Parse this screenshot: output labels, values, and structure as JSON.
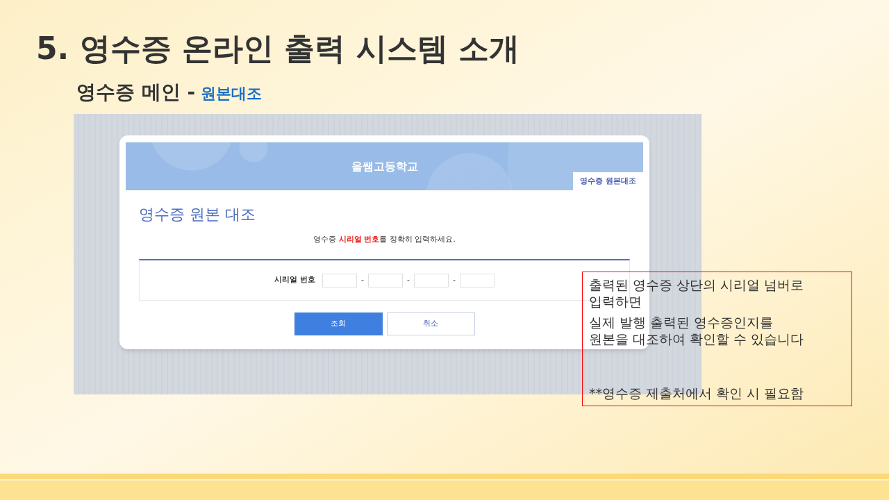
{
  "slide": {
    "title": "5. 영수증 온라인 출력 시스템 소개",
    "subtitle": "영수증 메인 -",
    "subtitle_highlight": "원본대조"
  },
  "page": {
    "school_name": "올쌤고등학교",
    "corner_tab": "영수증 원본대조",
    "heading": "영수증 원본 대조",
    "instruction": "영수증 **시리얼 번호**를 정확히 입력하세요.",
    "serial_label": "시리얼 번호",
    "separators": [
      "-",
      "-",
      "-"
    ],
    "buttons": [
      {
        "label": "조회",
        "kind": "primary"
      },
      {
        "label": "취소",
        "kind": "secondary"
      }
    ]
  },
  "callout": {
    "lines": [
      "출력된 영수증 상단의 시리얼 넘버로\n입력하면",
      "실제 발행 출력된 영수증인지를\n원본을 대조하여 확인할 수 있습니다",
      "**영수증 제출처에서 확인 시 필요함"
    ]
  }
}
